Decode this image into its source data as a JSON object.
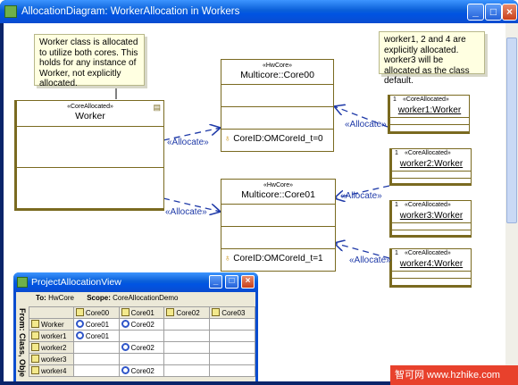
{
  "window": {
    "title": "AllocationDiagram: WorkerAllocation in Workers"
  },
  "notes": {
    "left": "Worker class is allocated to  utilize both cores. This holds for any instance of Worker, not explicitly allocated.",
    "right": "worker1, 2 and 4 are explicitly allocated. worker3 will be allocated as the class default."
  },
  "classes": {
    "worker": {
      "stereotype": "«CoreAllocated»",
      "name": "Worker"
    },
    "core00": {
      "stereotype": "«HwCore»",
      "name": "Multicore::Core00",
      "attr": "CoreID:OMCoreId_t=0"
    },
    "core01": {
      "stereotype": "«HwCore»",
      "name": "Multicore::Core01",
      "attr": "CoreID:OMCoreId_t=1"
    }
  },
  "instances": [
    {
      "mult": "1",
      "stereotype": "«CoreAllocated»",
      "name": "worker1:Worker"
    },
    {
      "mult": "1",
      "stereotype": "«CoreAllocated»",
      "name": "worker2:Worker"
    },
    {
      "mult": "1",
      "stereotype": "«CoreAllocated»",
      "name": "worker3:Worker"
    },
    {
      "mult": "1",
      "stereotype": "«CoreAllocated»",
      "name": "worker4:Worker"
    }
  ],
  "allocate_label": "«Allocate»",
  "allocation_view": {
    "title": "ProjectAllocationView",
    "to_label": "To:",
    "to_value": "HwCore",
    "scope_label": "Scope:",
    "scope_value": "CoreAllocationDemo",
    "from_label": "From: Class, Obje",
    "columns": [
      "Core00",
      "Core01",
      "Core02",
      "Core03"
    ],
    "rows": [
      {
        "name": "Worker",
        "cells": [
          "Core01",
          "Core02",
          "",
          ""
        ]
      },
      {
        "name": "worker1",
        "cells": [
          "Core01",
          "",
          "",
          ""
        ]
      },
      {
        "name": "worker2",
        "cells": [
          "",
          "Core02",
          "",
          ""
        ]
      },
      {
        "name": "worker3",
        "cells": [
          "",
          "",
          "",
          ""
        ]
      },
      {
        "name": "worker4",
        "cells": [
          "",
          "Core02",
          "",
          ""
        ]
      }
    ]
  },
  "watermark": "智可网 www.hzhike.com"
}
